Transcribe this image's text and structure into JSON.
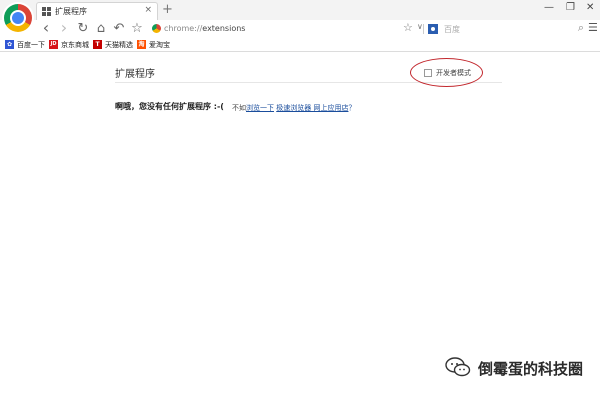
{
  "tab": {
    "title": "扩展程序",
    "close": "×"
  },
  "new_tab": "+",
  "window_controls": {
    "minimize": "—",
    "restore": "❐",
    "close": "✕"
  },
  "toolbar": {
    "back": "‹",
    "forward": "›",
    "reload": "↻",
    "home": "⌂",
    "undo": "↶",
    "bookmark_star": "☆"
  },
  "omnibox": {
    "url_scheme": "chrome://",
    "url_path": "extensions",
    "star": "☆",
    "dropdown": "∨"
  },
  "search": {
    "placeholder": "百度",
    "icon": "⌕"
  },
  "menu": "☰",
  "bookmarks": [
    {
      "label": "百度一下",
      "icon": "baidu-paw-icon",
      "color": "#2f55d4",
      "glyph": "✿"
    },
    {
      "label": "京东商城",
      "icon": "jd-icon",
      "color": "#d7141a",
      "glyph": "JD"
    },
    {
      "label": "天猫精选",
      "icon": "tmall-icon",
      "color": "#c40000",
      "glyph": "T"
    },
    {
      "label": "爱淘宝",
      "icon": "taobao-icon",
      "color": "#ff5000",
      "glyph": "淘"
    }
  ],
  "page": {
    "title": "扩展程序",
    "developer_mode_label": "开发者模式",
    "empty_message": "啊哦，您没有任何扩展程序 :-(",
    "suggest_prefix": "不如",
    "suggest_link_1": "浏览一下",
    "suggest_link_2": "极速浏览器 网上应用店",
    "suggest_suffix": "？"
  },
  "watermark": {
    "text": "倒霉蛋的科技圈",
    "icon": "wechat-icon"
  },
  "colors": {
    "highlight_ring": "#c2272d",
    "link": "#1a4d9c"
  }
}
